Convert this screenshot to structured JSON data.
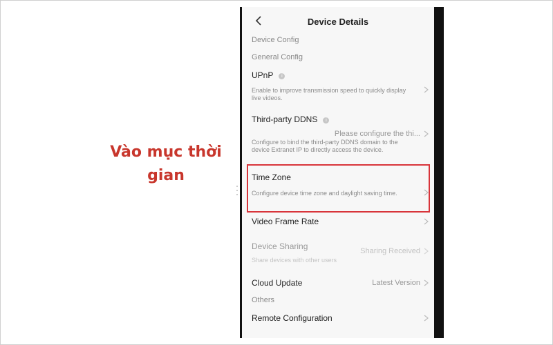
{
  "annotation": {
    "line1": "Vào mục thời",
    "line2": "gian",
    "color": "#c8362c"
  },
  "header": {
    "title": "Device Details",
    "back_icon": "chevron-left-icon"
  },
  "sections": {
    "device_config": "Device Config",
    "general_config": "General Config",
    "others": "Others"
  },
  "items": [
    {
      "title": "UPnP",
      "info_icon": "i",
      "description": "Enable to improve transmission speed to quickly display live videos.",
      "value": ""
    },
    {
      "title": "Third-party DDNS",
      "info_icon": "i",
      "description": "Configure to bind the third-party DDNS domain to the device Extranet IP to directly access the device.",
      "value": "Please configure the thi..."
    },
    {
      "title": "Time Zone",
      "description": "Configure device time zone and daylight saving time.",
      "value": ""
    },
    {
      "title": "Video Frame Rate",
      "description": "",
      "value": ""
    },
    {
      "title": "Device Sharing",
      "description": "Share devices with other users",
      "value": "Sharing Received"
    },
    {
      "title": "Cloud Update",
      "description": "",
      "value": "Latest Version"
    },
    {
      "title": "Remote Configuration",
      "description": "",
      "value": ""
    }
  ],
  "highlight_color": "#d8343a"
}
